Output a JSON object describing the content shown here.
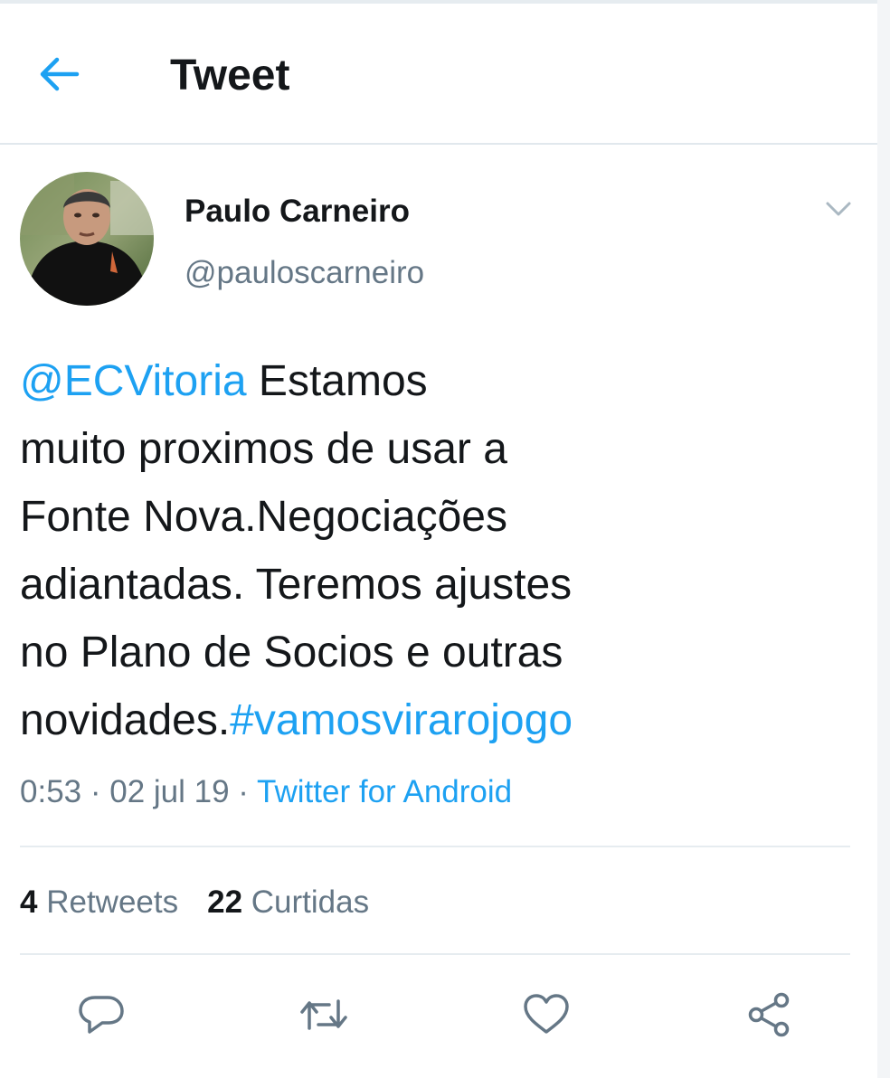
{
  "header": {
    "title": "Tweet",
    "back_icon": "arrow-left-icon"
  },
  "colors": {
    "accent": "#1da1f2",
    "text_primary": "#14171a",
    "text_secondary": "#657786",
    "divider": "#e6ecf0"
  },
  "tweet": {
    "author": {
      "name": "Paulo Carneiro",
      "handle": "@pauloscarneiro"
    },
    "menu_icon": "chevron-down-icon",
    "text": {
      "mention": "@ECVitoria",
      "line1_rest": " Estamos",
      "line2": "muito proximos de usar a",
      "line3": "Fonte Nova.Negociações",
      "line4": "adiantadas. Teremos ajustes",
      "line5": "no Plano de Socios e outras",
      "line6_prefix": "novidades.",
      "hashtag": "#vamosvirarojogo"
    },
    "meta": {
      "time": "0:53",
      "separator": " · ",
      "date": "02 jul 19",
      "source": "Twitter for Android"
    },
    "stats": {
      "retweets_count": "4",
      "retweets_label": "Retweets",
      "likes_count": "22",
      "likes_label": "Curtidas"
    },
    "actions": [
      {
        "icon": "reply-icon"
      },
      {
        "icon": "retweet-icon"
      },
      {
        "icon": "heart-icon"
      },
      {
        "icon": "share-icon"
      }
    ]
  }
}
